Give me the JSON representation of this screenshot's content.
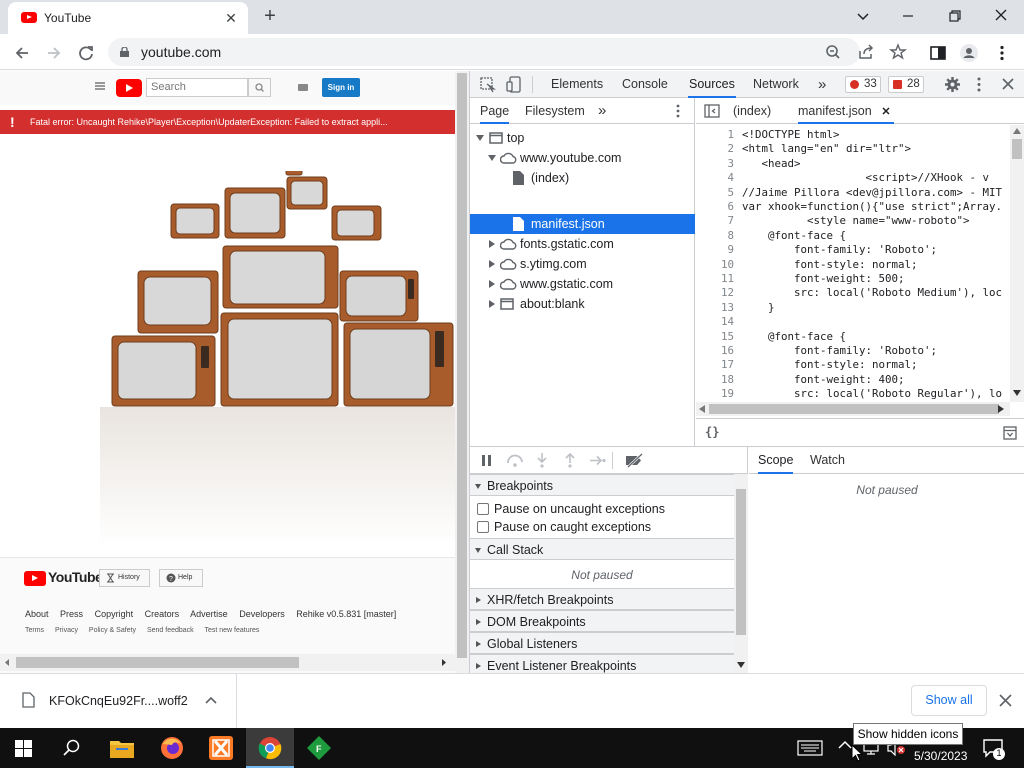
{
  "browser": {
    "tab_title": "YouTube",
    "url": "youtube.com"
  },
  "youtube": {
    "search_placeholder": "Search",
    "signin_label": "Sign in",
    "error_text": "Fatal error: Uncaught Rehike\\Player\\Exception\\UpdaterException: Failed to extract appli...",
    "footer_logo": "YouTube",
    "history_label": "History",
    "help_label": "Help",
    "footer_links": [
      "About",
      "Press",
      "Copyright",
      "Creators",
      "Advertise",
      "Developers",
      "Rehike v0.5.831 [master]"
    ],
    "footer_links2": [
      "Terms",
      "Privacy",
      "Policy & Safety",
      "Send feedback",
      "Test new features"
    ]
  },
  "devtools": {
    "tabs": [
      "Elements",
      "Console",
      "Sources",
      "Network"
    ],
    "active_tab": "Sources",
    "error_count": "33",
    "issue_count": "28",
    "nav_tabs": [
      "Page",
      "Filesystem"
    ],
    "tree": [
      {
        "label": "top"
      },
      {
        "label": "www.youtube.com"
      },
      {
        "label": "(index)"
      },
      {
        "label": "manifest.json"
      },
      {
        "label": "fonts.gstatic.com"
      },
      {
        "label": "s.ytimg.com"
      },
      {
        "label": "www.gstatic.com"
      },
      {
        "label": "about:blank"
      }
    ],
    "editor_tabs": [
      "(index)",
      "manifest.json"
    ],
    "pretty_print": "{}",
    "code_lines": [
      "<!DOCTYPE html>",
      "<html lang=\"en\" dir=\"ltr\">",
      "   <head>",
      "                   <script>//XHook - v",
      "//Jaime Pillora <dev@jpillora.com> - MIT",
      "var xhook=function(){\"use strict\";Array.",
      "          <style name=\"www-roboto\">",
      "    @font-face {",
      "        font-family: 'Roboto';",
      "        font-style: normal;",
      "        font-weight: 500;",
      "        src: local('Roboto Medium'), loc",
      "    }",
      "",
      "    @font-face {",
      "        font-family: 'Roboto';",
      "        font-style: normal;",
      "        font-weight: 400;",
      "        src: local('Roboto Regular'), lo"
    ],
    "sections": {
      "breakpoints": "Breakpoints",
      "pause_uncaught": "Pause on uncaught exceptions",
      "pause_caught": "Pause on caught exceptions",
      "call_stack": "Call Stack",
      "not_paused": "Not paused",
      "xhr": "XHR/fetch Breakpoints",
      "dom": "DOM Breakpoints",
      "global": "Global Listeners",
      "event": "Event Listener Breakpoints"
    },
    "scope_tabs": [
      "Scope",
      "Watch"
    ],
    "scope_status": "Not paused"
  },
  "download": {
    "file": "KFOkCnqEu92Fr....woff2",
    "show_all": "Show all"
  },
  "taskbar": {
    "tooltip": "Show hidden icons",
    "date": "5/30/2023",
    "notif_count": "1"
  },
  "colors": {
    "accent": "#1a73e8",
    "yt_red": "#ff0000",
    "error_banner": "#d32f2f"
  }
}
